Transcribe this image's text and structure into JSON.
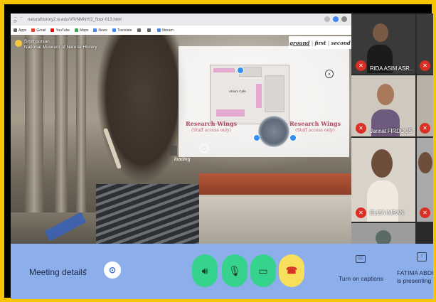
{
  "browser": {
    "url": "naturalhistory2.si.edu/VR/NMNH/2_floor-013.html",
    "bookmarks": [
      {
        "label": "Apps",
        "color": "#5f6368"
      },
      {
        "label": "Gmail",
        "color": "#ea4335"
      },
      {
        "label": "YouTube",
        "color": "#ff0000"
      },
      {
        "label": "Maps",
        "color": "#34a853"
      },
      {
        "label": "News",
        "color": "#4285f4"
      },
      {
        "label": "Translate",
        "color": "#4285f4"
      },
      {
        "label": "",
        "color": "#5f6368"
      },
      {
        "label": "",
        "color": "#5f6368"
      },
      {
        "label": "Stream",
        "color": "#4285f4"
      }
    ]
  },
  "tour": {
    "logo_line1": "Smithsonian",
    "logo_line2": "National Museum of Natural History",
    "floors": [
      "ground",
      "first",
      "second"
    ],
    "active_floor": "ground",
    "map": {
      "cafe_label": "Atrium Cafe",
      "left_wing_title": "Research Wings",
      "left_wing_sub": "(Staff access only)",
      "right_wing_title": "Research Wings",
      "right_wing_sub": "(Staff access only)",
      "close_symbol": "×"
    },
    "loading_text": "loading"
  },
  "participants": [
    {
      "name": "RIDA ASIM ASR...",
      "muted": true
    },
    {
      "name": "Jannat FIRDOUS",
      "muted": true
    },
    {
      "name": "ELIZA IMRAN",
      "muted": true
    },
    {
      "name": "",
      "muted": true
    }
  ],
  "toolbar": {
    "meeting_details": "Meeting details",
    "captions_icon_text": "CC",
    "captions_label": "Turn on captions",
    "presenting_label": "FATIMA ABDU... is presenting"
  },
  "colors": {
    "frame": "#f7c400",
    "toolbar_bg": "#8caeea",
    "control_green": "#35d38c",
    "end_call": "#f7df5b",
    "mic_off": "#d93025"
  }
}
